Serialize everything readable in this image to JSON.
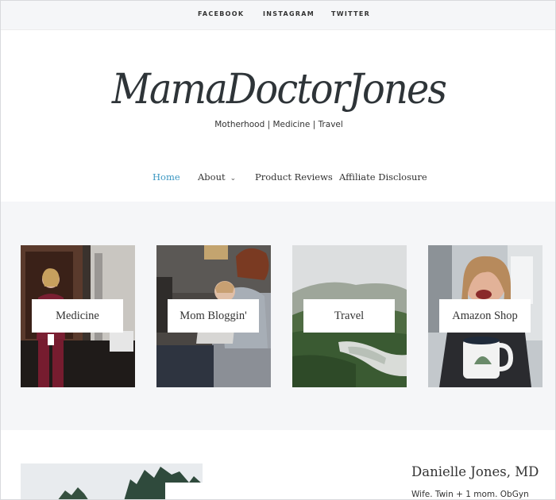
{
  "social": [
    {
      "label": "FACEBOOK"
    },
    {
      "label": "INSTAGRAM"
    },
    {
      "label": "TWITTER"
    }
  ],
  "site": {
    "logo": "MamaDoctorJones",
    "tagline": "Motherhood | Medicine | Travel"
  },
  "nav": {
    "items": [
      {
        "label": "Home",
        "active": true
      },
      {
        "label": "About",
        "has_dropdown": true
      },
      {
        "label": "Product Reviews"
      },
      {
        "label": "Affiliate Disclosure"
      }
    ]
  },
  "categories": [
    {
      "label": "Medicine"
    },
    {
      "label": "Mom Bloggin'"
    },
    {
      "label": "Travel"
    },
    {
      "label": "Amazon Shop"
    }
  ],
  "about": {
    "name": "Danielle Jones, MD",
    "bio": "Wife. Twin + 1 mom. ObGyn"
  },
  "colors": {
    "accent": "#3b97c2",
    "band_bg": "#f5f6f8",
    "text": "#333333",
    "logo": "#2e3438"
  }
}
